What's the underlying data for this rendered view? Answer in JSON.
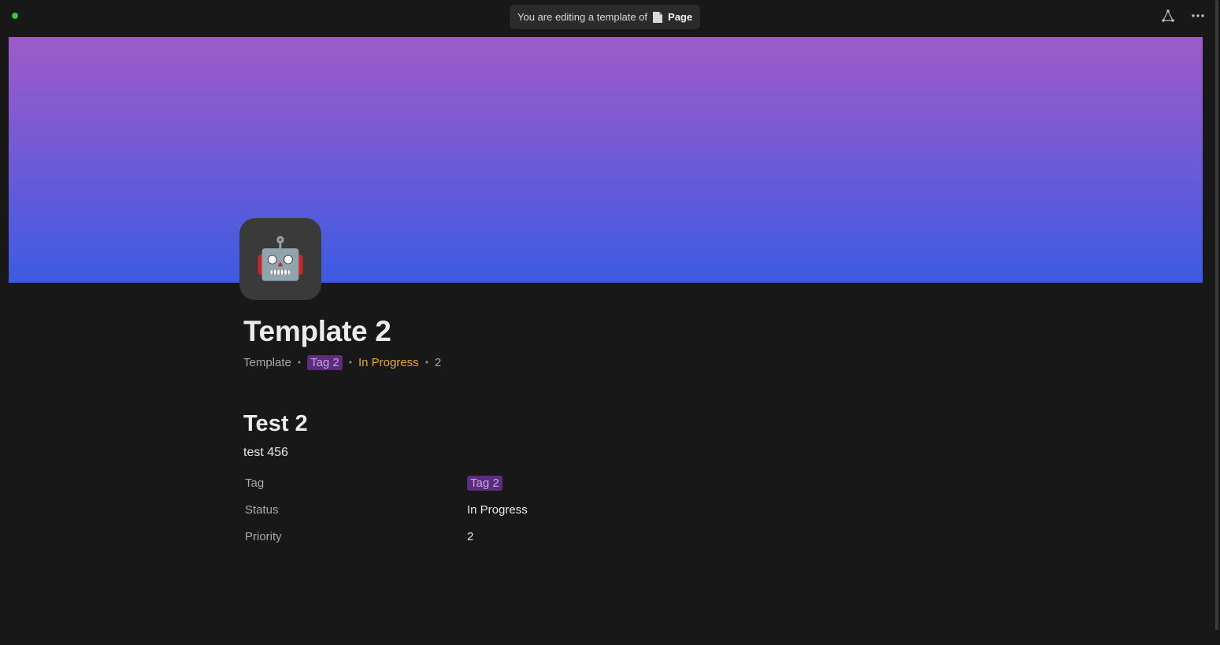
{
  "topbar": {
    "banner_prefix": "You are editing a template of",
    "banner_page": "Page",
    "status_color": "#3fbf4a",
    "icons": [
      "graph-icon",
      "more-icon"
    ]
  },
  "cover": {
    "gradient_top": "#9d5bc9",
    "gradient_bottom": "#3c5be3"
  },
  "page": {
    "icon": "🤖",
    "title": "Template 2",
    "meta": {
      "type": "Template",
      "tag": "Tag 2",
      "status": "In Progress",
      "priority": "2"
    }
  },
  "content": {
    "heading": "Test 2",
    "text": "test 456",
    "properties": [
      {
        "key": "Tag",
        "value": "Tag 2"
      },
      {
        "key": "Status",
        "value": "In Progress"
      },
      {
        "key": "Priority",
        "value": "2"
      }
    ]
  }
}
